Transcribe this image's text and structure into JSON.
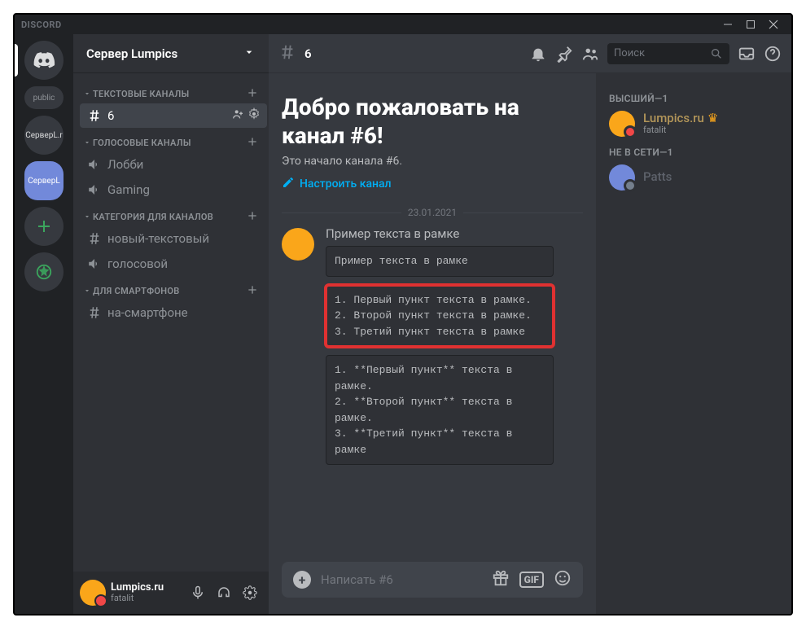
{
  "titlebar": {
    "brand": "DISCORD"
  },
  "guilds": {
    "folder": "public",
    "g1": "СерверL.r",
    "g2": "СерверL"
  },
  "server": {
    "name": "Сервер Lumpics"
  },
  "categories": {
    "text": "ТЕКСТОВЫЕ КАНАЛЫ",
    "voice": "ГОЛОСОВЫЕ КАНАЛЫ",
    "cat": "КАТЕГОРИЯ ДЛЯ КАНАЛОВ",
    "phone": "ДЛЯ СМАРТФОНОВ"
  },
  "channels": {
    "c6": "6",
    "lobby": "Лобби",
    "gaming": "Gaming",
    "newtext": "новый-текстовый",
    "voice2": "голосовой",
    "phone": "на-смартфоне"
  },
  "user": {
    "name": "Lumpics.ru",
    "status": "fatalit"
  },
  "header": {
    "channel": "6",
    "search_ph": "Поиск"
  },
  "welcome": {
    "title": "Добро пожаловать на канал #6!",
    "sub": "Это начало канала #6.",
    "setup": "Настроить канал"
  },
  "divider_date": "23.01.2021",
  "message": {
    "head": "Пример текста в рамке",
    "code1": "Пример текста в рамке",
    "code2": "1. Первый пункт текста в рамке.\n2. Второй пункт текста в рамке.\n3. Третий пункт текста в рамке",
    "code3": "1. **Первый пункт** текста в рамке.\n2. **Второй пункт** текста в рамке.\n3. **Третий пункт** текста в рамке"
  },
  "composer": {
    "placeholder": "Написать #6",
    "gif": "GIF"
  },
  "members": {
    "cat1": "ВЫСШИЙ—1",
    "m1_name": "Lumpics.ru",
    "m1_status": "fatalit",
    "cat2": "НЕ В СЕТИ—1",
    "m2_name": "Patts"
  }
}
